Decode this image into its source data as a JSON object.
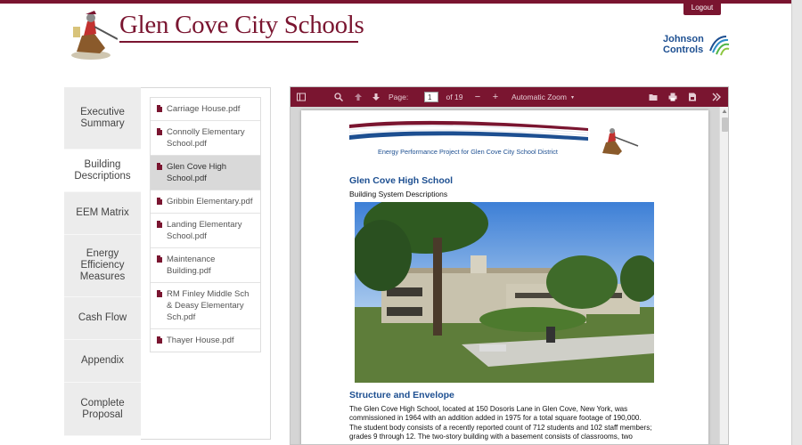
{
  "header": {
    "brand": "Glen Cove City Schools",
    "logout_label": "Logout",
    "partner_line1": "Johnson",
    "partner_line2": "Controls"
  },
  "tabs": [
    {
      "label": "Executive Summary",
      "active": false
    },
    {
      "label": "Building Descriptions",
      "active": true
    },
    {
      "label": "EEM Matrix",
      "active": false
    },
    {
      "label": "Energy Efficiency Measures",
      "active": false
    },
    {
      "label": "Cash Flow",
      "active": false
    },
    {
      "label": "Appendix",
      "active": false
    },
    {
      "label": "Complete Proposal",
      "active": false
    }
  ],
  "files": [
    {
      "label": "Carriage House.pdf"
    },
    {
      "label": "Connolly Elementary School.pdf"
    },
    {
      "label": "Glen Cove High School.pdf",
      "active": true
    },
    {
      "label": "Gribbin Elementary.pdf"
    },
    {
      "label": "Landing Elementary School.pdf"
    },
    {
      "label": "Maintenance Building.pdf"
    },
    {
      "label": "RM Finley Middle Sch & Deasy Elementary Sch.pdf"
    },
    {
      "label": "Thayer House.pdf"
    }
  ],
  "viewer": {
    "page_label": "Page:",
    "page_value": "1",
    "page_total": "of 19",
    "zoom_label": "Automatic Zoom",
    "zoom_out": "−",
    "zoom_in": "+"
  },
  "document": {
    "header_text": "Energy Performance Project for Glen Cove City School District",
    "title": "Glen Cove High School",
    "subtitle": "Building System Descriptions",
    "section_title": "Structure and Envelope",
    "body": "The Glen Cove High School, located at 150 Dosoris Lane in Glen Cove, New York, was commissioned in 1964 with an addition added in 1975 for a total square footage of 190,000. The student body consists of a recently reported count of 712 students and 102 staff members; grades 9 through 12. The two-story building with a basement consists of classrooms, two"
  },
  "colors": {
    "brand": "#7a1530",
    "doc_blue": "#1d4f91"
  },
  "icons": {
    "sidebar": "sidebar-toggle-icon",
    "search": "search-icon",
    "prev": "arrow-up-icon",
    "next": "arrow-down-icon",
    "open": "folder-open-icon",
    "print": "print-icon",
    "download": "download-icon",
    "tools": "double-chevron-icon"
  }
}
